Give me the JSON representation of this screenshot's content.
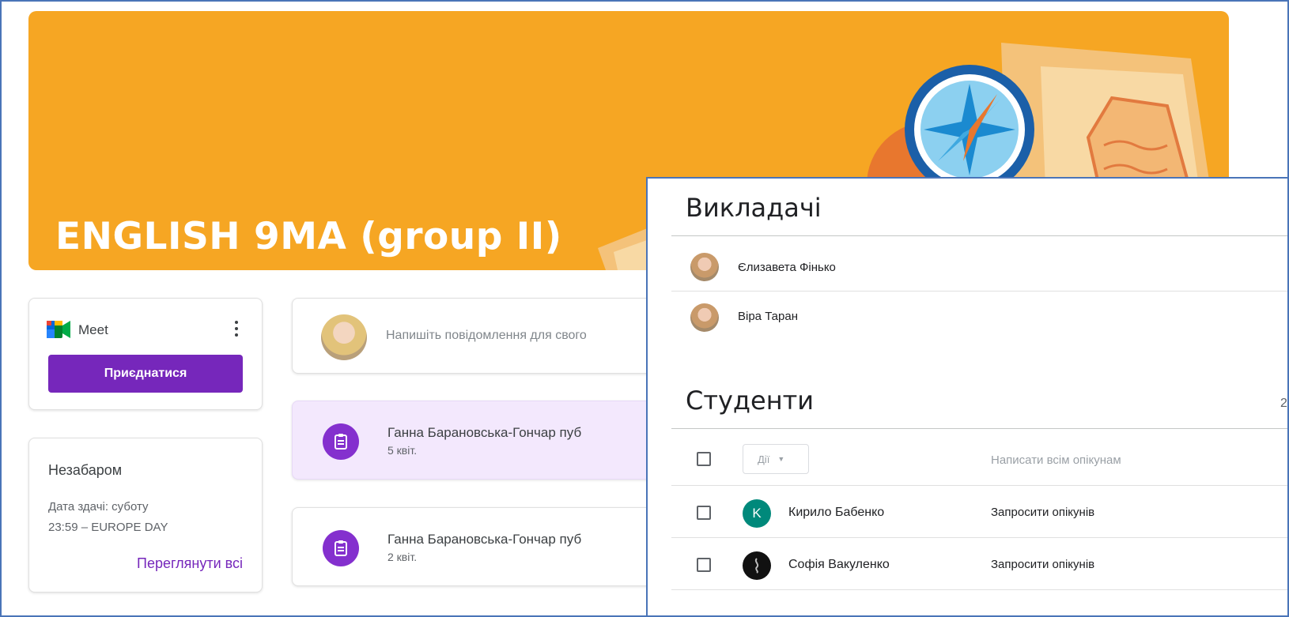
{
  "banner": {
    "title": "ENGLISH 9MA (group II)"
  },
  "meet": {
    "label": "Meet",
    "join_label": "Приєднатися"
  },
  "upcoming": {
    "title": "Незабаром",
    "due_date": "Дата здачі: суботу",
    "due_item": "23:59 – EUROPE DAY",
    "view_all": "Переглянути всі"
  },
  "post": {
    "placeholder": "Напишіть повідомлення для свого"
  },
  "stream": [
    {
      "author": "Ганна Барановська-Гончар пуб",
      "date": "5 квіт."
    },
    {
      "author": "Ганна Барановська-Гончар пуб",
      "date": "2 квіт."
    }
  ],
  "teachers": {
    "title": "Викладачі",
    "list": [
      {
        "name": "Єлизавета Фінько"
      },
      {
        "name": "Віра Таран"
      }
    ]
  },
  "students": {
    "title": "Студенти",
    "count": "2",
    "actions_label": "Дії",
    "email_guardians": "Написати всім опікунам",
    "list": [
      {
        "initial": "K",
        "name": "Кирило Бабенко",
        "invite": "Запросити опікунів",
        "color": "#00897b"
      },
      {
        "initial": "",
        "name": "Софія Вакуленко",
        "invite": "Запросити опікунів",
        "color": "#111111"
      }
    ]
  },
  "colors": {
    "banner": "#f6a623",
    "accent": "#7627bb",
    "frame": "#4a74b8"
  }
}
